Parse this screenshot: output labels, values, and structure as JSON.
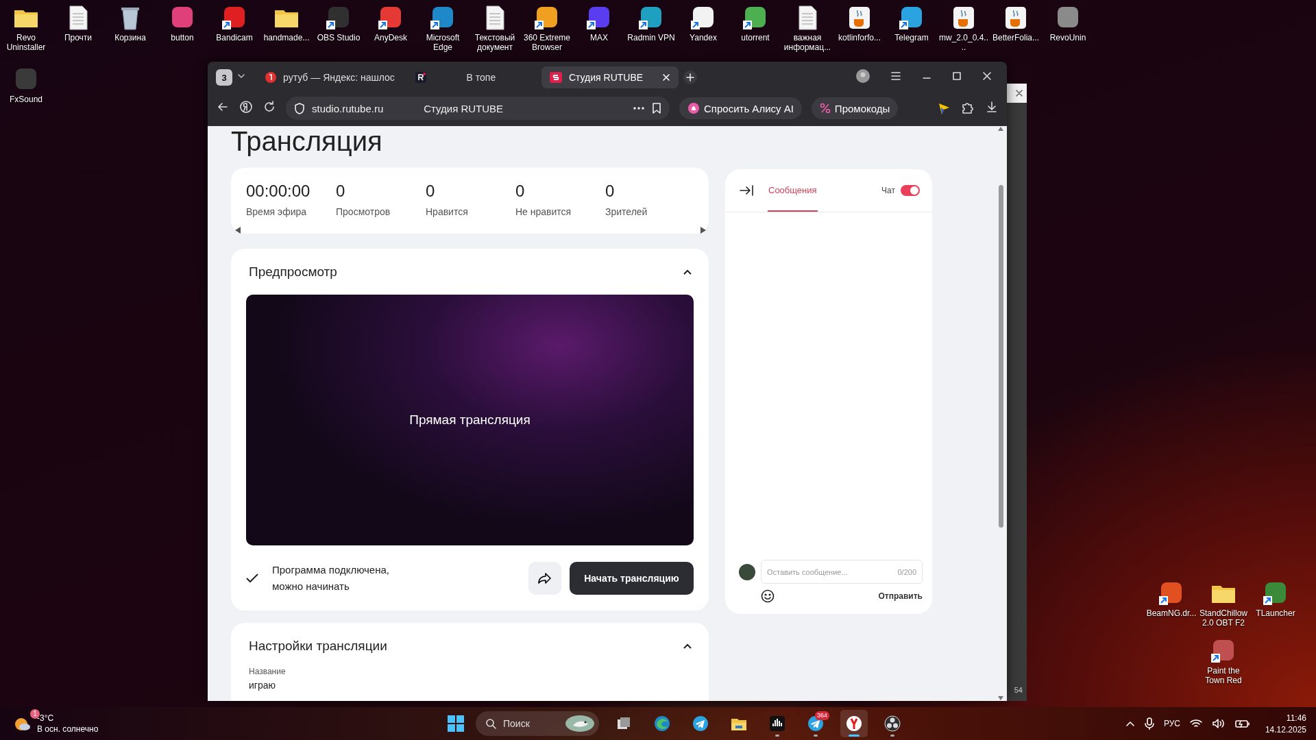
{
  "desktop_icons": [
    {
      "label": "Revo Uninstaller",
      "kind": "folder",
      "shortcut": false
    },
    {
      "label": "Прочти",
      "kind": "document",
      "shortcut": false
    },
    {
      "label": "Корзина",
      "kind": "recycle-bin",
      "shortcut": false
    },
    {
      "label": "button",
      "kind": "app",
      "color": "#e0407a",
      "shortcut": false
    },
    {
      "label": "Bandicam",
      "kind": "app",
      "color": "#e02020",
      "shortcut": true
    },
    {
      "label": "handmade...",
      "kind": "folder",
      "shortcut": false
    },
    {
      "label": "OBS Studio",
      "kind": "app",
      "color": "#303030",
      "shortcut": true
    },
    {
      "label": "AnyDesk",
      "kind": "app",
      "color": "#e53935",
      "shortcut": true
    },
    {
      "label": "Microsoft Edge",
      "kind": "app",
      "color": "#1e88c8",
      "shortcut": true
    },
    {
      "label": "Текстовый документ",
      "kind": "document",
      "shortcut": false
    },
    {
      "label": "360 Extreme Browser",
      "kind": "app",
      "color": "#f0a020",
      "shortcut": true
    },
    {
      "label": "MAX",
      "kind": "app",
      "color": "#5b3df0",
      "shortcut": true
    },
    {
      "label": "Radmin VPN",
      "kind": "app",
      "color": "#20a0c0",
      "shortcut": true
    },
    {
      "label": "Yandex",
      "kind": "app",
      "color": "#f2f2f2",
      "shortcut": true
    },
    {
      "label": "utorrent",
      "kind": "app",
      "color": "#4caf50",
      "shortcut": true
    },
    {
      "label": "важная информац...",
      "kind": "document",
      "shortcut": false
    },
    {
      "label": "kotlinforfo...",
      "kind": "java",
      "shortcut": false
    },
    {
      "label": "Telegram",
      "kind": "app",
      "color": "#2aa3e0",
      "shortcut": true
    },
    {
      "label": "mw_2.0_0.4....",
      "kind": "java",
      "shortcut": false
    },
    {
      "label": "BetterFolia...",
      "kind": "java",
      "shortcut": false
    },
    {
      "label": "RevoUnin",
      "kind": "app",
      "color": "#8a8a8a",
      "shortcut": false
    }
  ],
  "desktop_icons_left": [
    {
      "label": "FxSound",
      "kind": "app",
      "color": "#3a3a3a",
      "shortcut": false
    }
  ],
  "desktop_icons_right": [
    {
      "label": "BeamNG.dr...",
      "kind": "app",
      "color": "#e05020",
      "shortcut": true
    },
    {
      "label": "StandChillow 2.0 OBT F2",
      "kind": "folder",
      "shortcut": false
    },
    {
      "label": "TLauncher",
      "kind": "app",
      "color": "#3a8a3a",
      "shortcut": true
    }
  ],
  "desktop_icons_right_lower": [
    {
      "label": "Paint the Town Red",
      "kind": "app",
      "color": "#c05050",
      "shortcut": true
    }
  ],
  "background_window": {
    "text": "54"
  },
  "browser": {
    "tab_count": "3",
    "tabs": [
      {
        "title": "рутуб — Яндекс: нашлос",
        "selected": false,
        "kind": "search"
      },
      {
        "title": "В топе",
        "selected": false,
        "kind": "site"
      },
      {
        "title": "Студия RUTUBE",
        "selected": true,
        "kind": "studio"
      }
    ],
    "address": "studio.rutube.ru",
    "page_title": "Студия RUTUBE",
    "alice_button": "Спросить Алису AI",
    "promo_button": "Промокоды"
  },
  "page": {
    "heading": "Трансляция",
    "stats": [
      {
        "value": "00:00:00",
        "label": "Время эфира"
      },
      {
        "value": "0",
        "label": "Просмотров"
      },
      {
        "value": "0",
        "label": "Нравится"
      },
      {
        "value": "0",
        "label": "Не нравится"
      },
      {
        "value": "0",
        "label": "Зрителей"
      }
    ],
    "preview": {
      "title": "Предпросмотр",
      "expanded": true,
      "video_caption": "Прямая трансляция",
      "status": "Программа подключена, можно начинать",
      "start_button": "Начать трансляцию"
    },
    "settings": {
      "title": "Настройки трансляции",
      "expanded": true,
      "field_label": "Название",
      "field_value": "играю"
    }
  },
  "chat": {
    "tab": "Сообщения",
    "toggle_label": "Чат",
    "chat_on": true,
    "placeholder": "Оставить сообщение...",
    "counter": "0/200",
    "send": "Отправить"
  },
  "taskbar": {
    "weather_badge": "1",
    "weather_temp": "-3°C",
    "weather_desc": "В осн. солнечно",
    "search_placeholder": "Поиск",
    "apps": [
      {
        "kind": "task-view",
        "running": false,
        "selected": false
      },
      {
        "kind": "edge",
        "running": false,
        "selected": false
      },
      {
        "kind": "telegram",
        "running": false,
        "selected": false
      },
      {
        "kind": "explorer",
        "running": false,
        "selected": false
      },
      {
        "kind": "equalizer",
        "running": true,
        "selected": false
      },
      {
        "kind": "telegram",
        "running": true,
        "selected": false,
        "badge": "364"
      },
      {
        "kind": "yandex",
        "selected": true
      },
      {
        "kind": "obs",
        "running": true,
        "selected": false
      }
    ],
    "language": "РУС",
    "time": "11:46",
    "date": "14.12.2025"
  }
}
